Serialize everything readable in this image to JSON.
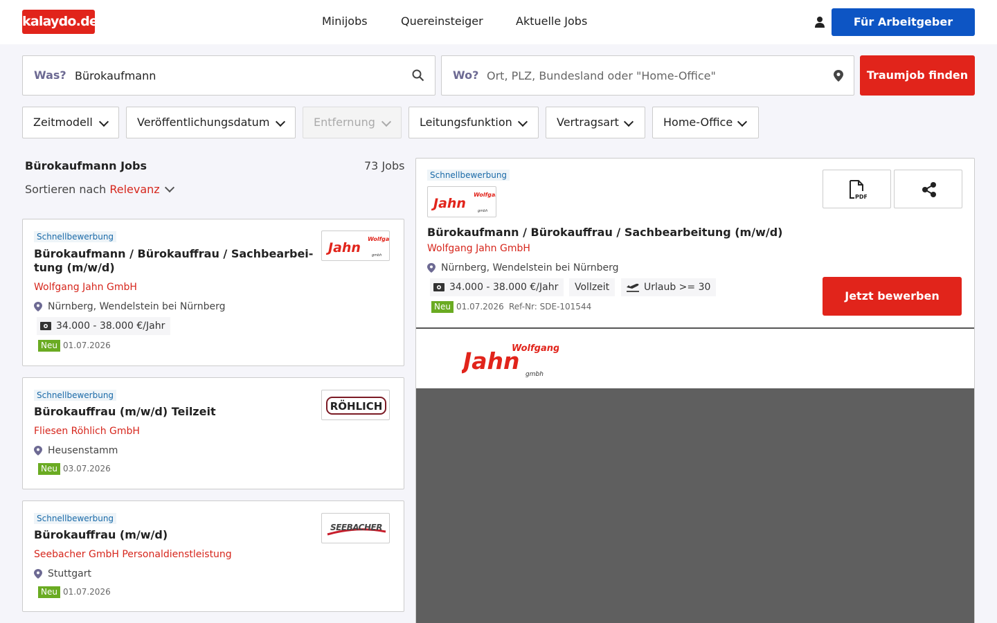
{
  "header": {
    "logo_text": "kalaydo.de",
    "nav": [
      "Minijobs",
      "Quereinsteiger",
      "Aktuelle Jobs"
    ],
    "employer_button": "Für Arbeitgeber"
  },
  "search": {
    "what_label": "Was?",
    "what_value": "Bürokaufmann",
    "where_label": "Wo?",
    "where_placeholder": "Ort, PLZ, Bundesland oder \"Home-Office\"",
    "submit_label": "Traumjob finden"
  },
  "filters": [
    "Zeitmodell",
    "Veröffentlichungsdatum",
    "Entfernung",
    "Leitungsfunktion",
    "Vertragsart",
    "Home-Office"
  ],
  "results": {
    "title": "Bürokaufmann Jobs",
    "count": "73 Jobs",
    "sort_label": "Sortieren nach",
    "sort_value": "Relevanz"
  },
  "jobs": [
    {
      "badge": "Schnellbewerbung",
      "title": "Bürokaufmann / Bürokauffrau / Sachbearbei- tung (m/w/d)",
      "company": "Wolfgang Jahn GmbH",
      "location": "Nürnberg, Wendelstein bei Nürnberg",
      "salary": "34.000 - 38.000 €/Jahr",
      "new_label": "Neu",
      "date": "01.07.2026"
    },
    {
      "badge": "Schnellbewerbung",
      "title": "Bürokauffrau (m/w/d) Teilzeit",
      "company": "Fliesen Röhlich GmbH",
      "location": "Heusenstamm",
      "new_label": "Neu",
      "date": "03.07.2026"
    },
    {
      "badge": "Schnellbewerbung",
      "title": "Bürokauffrau (m/w/d)",
      "company": "Seebacher GmbH Personaldienstleistung",
      "location": "Stuttgart",
      "new_label": "Neu",
      "date": "01.07.2026"
    }
  ],
  "logos": {
    "jahn_top": "Wolfgang",
    "jahn_main": "Jahn",
    "jahn_sub": "gmbh",
    "roehlich": "RÖHLICH",
    "seebacher": "SEEBACHER"
  },
  "detail": {
    "badge": "Schnellbewerbung",
    "title": "Bürokaufmann / Bürokauffrau / Sachbearbeitung (m/w/d)",
    "company": "Wolfgang Jahn GmbH",
    "location": "Nürnberg, Wendelstein bei Nürnberg",
    "salary": "34.000 - 38.000 €/Jahr",
    "contract": "Vollzeit",
    "vacation": "Urlaub >= 30",
    "new_label": "Neu",
    "date": "01.07.2026",
    "ref": "Ref-Nr: SDE-101544",
    "apply_label": "Jetzt bewerben"
  },
  "colors": {
    "brand_red": "#e1241b",
    "employer_blue": "#0d55c4",
    "new_green": "#6aab22",
    "link_red": "#d6261c"
  }
}
